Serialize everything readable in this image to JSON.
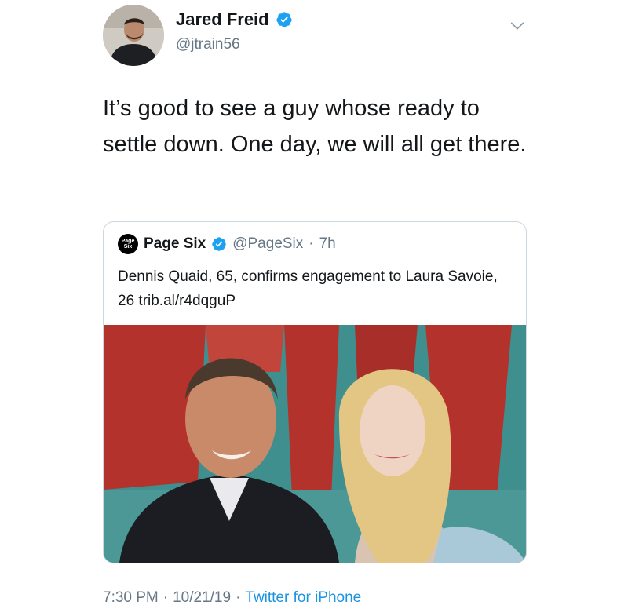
{
  "author": {
    "display_name": "Jared Freid",
    "handle": "@jtrain56",
    "verified": true,
    "avatar_icon": "user-avatar-photo"
  },
  "tweet": {
    "text": "It’s good to see a guy whose ready to settle down. One day, we will all get there."
  },
  "quoted": {
    "logo_text_line1": "Page",
    "logo_text_line2": "Six",
    "display_name": "Page Six",
    "verified": true,
    "handle": "@PageSix",
    "separator": "·",
    "time": "7h",
    "text": "Dennis Quaid, 65, confirms engagement to Laura Savoie, 26 trib.al/r4dqguP"
  },
  "footer": {
    "time": "7:30 PM",
    "sep1": "·",
    "date": "10/21/19",
    "sep2": "·",
    "source": "Twitter for iPhone"
  },
  "colors": {
    "verified": "#1da1f2",
    "link": "#1b95e0",
    "muted": "#657786",
    "text": "#14171a",
    "backdrop_red": "#b3322c",
    "backdrop_teal": "#3f8f8e"
  },
  "icons": {
    "verified": "verified-badge-icon",
    "chevron": "chevron-down-icon"
  }
}
